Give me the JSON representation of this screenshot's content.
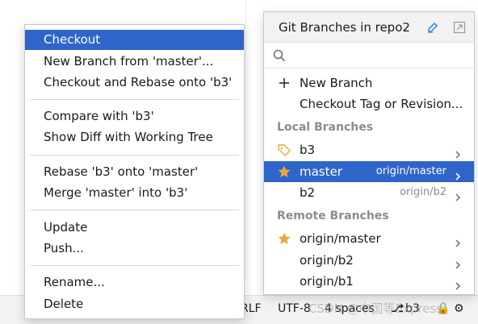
{
  "context_menu": {
    "items": [
      {
        "label": "Checkout",
        "selected": true
      },
      {
        "label": "New Branch from 'master'..."
      },
      {
        "label": "Checkout and Rebase onto 'b3'"
      },
      {
        "label": "Compare with 'b3'"
      },
      {
        "label": "Show Diff with Working Tree"
      },
      {
        "label": "Rebase 'b3' onto 'master'"
      },
      {
        "label": "Merge 'master' into 'b3'"
      },
      {
        "label": "Update"
      },
      {
        "label": "Push..."
      },
      {
        "label": "Rename..."
      },
      {
        "label": "Delete"
      }
    ]
  },
  "branches_popup": {
    "title": "Git Branches in repo2",
    "search_placeholder": "",
    "actions": [
      {
        "label": "New Branch",
        "icon": "plus-icon"
      },
      {
        "label": "Checkout Tag or Revision...",
        "icon": ""
      }
    ],
    "local_section_title": "Local Branches",
    "local_branches": [
      {
        "name": "b3",
        "icon": "tag-icon",
        "tracking": "",
        "selected": false
      },
      {
        "name": "master",
        "icon": "star-icon",
        "tracking": "origin/master",
        "selected": true
      },
      {
        "name": "b2",
        "icon": "",
        "tracking": "origin/b2",
        "selected": false
      }
    ],
    "remote_section_title": "Remote Branches",
    "remote_branches": [
      {
        "name": "origin/master",
        "icon": "star-icon"
      },
      {
        "name": "origin/b2",
        "icon": ""
      },
      {
        "name": "origin/b1",
        "icon": ""
      }
    ]
  },
  "status_bar": {
    "line_sep": "RLF",
    "encoding": "UTF-8",
    "indent": "4 spaces",
    "branch": "b3"
  },
  "watermark": "CSDN @中国等Express",
  "colors": {
    "selection": "#2f65ca",
    "star": "#f0a732",
    "section_title": "#8c8c8c"
  }
}
